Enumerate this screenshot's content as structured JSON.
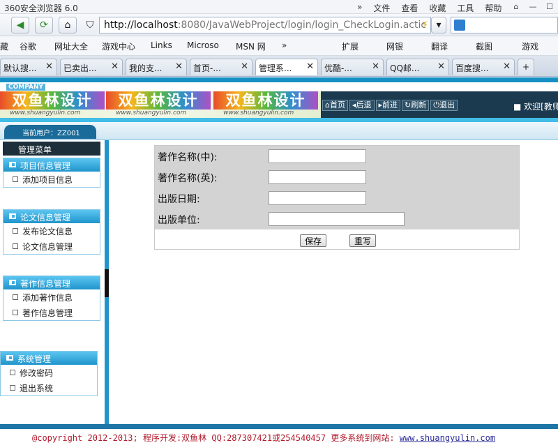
{
  "browser": {
    "title": "360安全浏览器 6.0",
    "menu": [
      "»",
      "文件",
      "查看",
      "收藏",
      "工具",
      "帮助"
    ],
    "address_host": "http://localhost",
    "address_rest": ":8080/JavaWebProject/login/login_CheckLogin.actic",
    "favorites": [
      "藏",
      "谷歌",
      "网址大全",
      "游戏中心",
      "Links",
      "Microso",
      "MSN 网",
      "»",
      "扩展",
      "网银",
      "翻译",
      "截图",
      "游戏"
    ],
    "tabs": [
      {
        "label": "默认搜..."
      },
      {
        "label": "已卖出..."
      },
      {
        "label": "我的支..."
      },
      {
        "label": "首页-..."
      },
      {
        "label": "管理系..."
      },
      {
        "label": "优酷-..."
      },
      {
        "label": "QQ邮..."
      },
      {
        "label": "百度搜..."
      }
    ],
    "new_tab": "+"
  },
  "header": {
    "company": "COMPANY",
    "logo_text": "双鱼林设计",
    "logo_url": "www.shuangyulin.com",
    "nav": [
      "首页",
      "后退",
      "前进",
      "刷新",
      "退出"
    ],
    "welcome": "欢迎[教师"
  },
  "user": {
    "current": "当前用户：ZZ001"
  },
  "sidebar": {
    "title": "管理菜单",
    "groups": [
      {
        "title": "项目信息管理",
        "items": [
          "添加项目信息"
        ]
      },
      {
        "title": "论文信息管理",
        "items": [
          "发布论文信息",
          "论文信息管理"
        ]
      },
      {
        "title": "著作信息管理",
        "items": [
          "添加著作信息",
          "著作信息管理"
        ]
      },
      {
        "title": "系统管理",
        "items": [
          "修改密码",
          "退出系统"
        ]
      }
    ]
  },
  "form": {
    "fields": [
      {
        "label": "著作名称(中):",
        "value": ""
      },
      {
        "label": "著作名称(英):",
        "value": ""
      },
      {
        "label": "出版日期:",
        "value": ""
      },
      {
        "label": "出版单位:",
        "value": ""
      }
    ],
    "save": "保存",
    "reset": "重写"
  },
  "footer": {
    "text": "@copyright 2012-2013; 程序开发:双鱼林  QQ:287307421或254540457  更多系统到网站: ",
    "link": "www.shuangyulin.com"
  }
}
